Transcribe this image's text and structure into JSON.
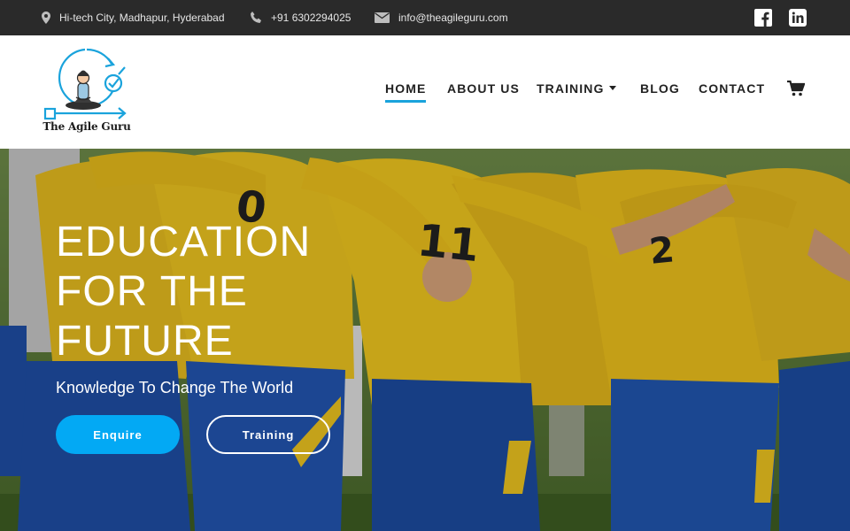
{
  "topbar": {
    "address": "Hi-tech City, Madhapur, Hyderabad",
    "phone": "+91 6302294025",
    "email": "info@theagileguru.com",
    "address_icon": "map-pin-icon",
    "phone_icon": "phone-icon",
    "email_icon": "envelope-icon",
    "social": [
      "facebook-icon",
      "linkedin-icon"
    ]
  },
  "logo": {
    "text": "The Agile Guru"
  },
  "nav": {
    "items": [
      {
        "label": "HOME",
        "active": true
      },
      {
        "label": "ABOUT US"
      },
      {
        "label": "TRAINING",
        "has_dropdown": true
      },
      {
        "label": "BLOG"
      },
      {
        "label": "CONTACT"
      }
    ],
    "cart_icon": "shopping-cart-icon",
    "accent": "#1aa3dc"
  },
  "hero": {
    "title_lines": [
      "EDUCATION",
      "FOR THE",
      "FUTURE"
    ],
    "subtitle": "Knowledge To Change The World",
    "buttons": [
      {
        "label": "Enquire",
        "color": "#03a9f4"
      },
      {
        "label": "Training"
      }
    ]
  },
  "colors": {
    "topbar_bg": "#2a2a2a",
    "jersey_yellow": "#f2c31a",
    "shorts_blue": "#1f4fa6"
  }
}
